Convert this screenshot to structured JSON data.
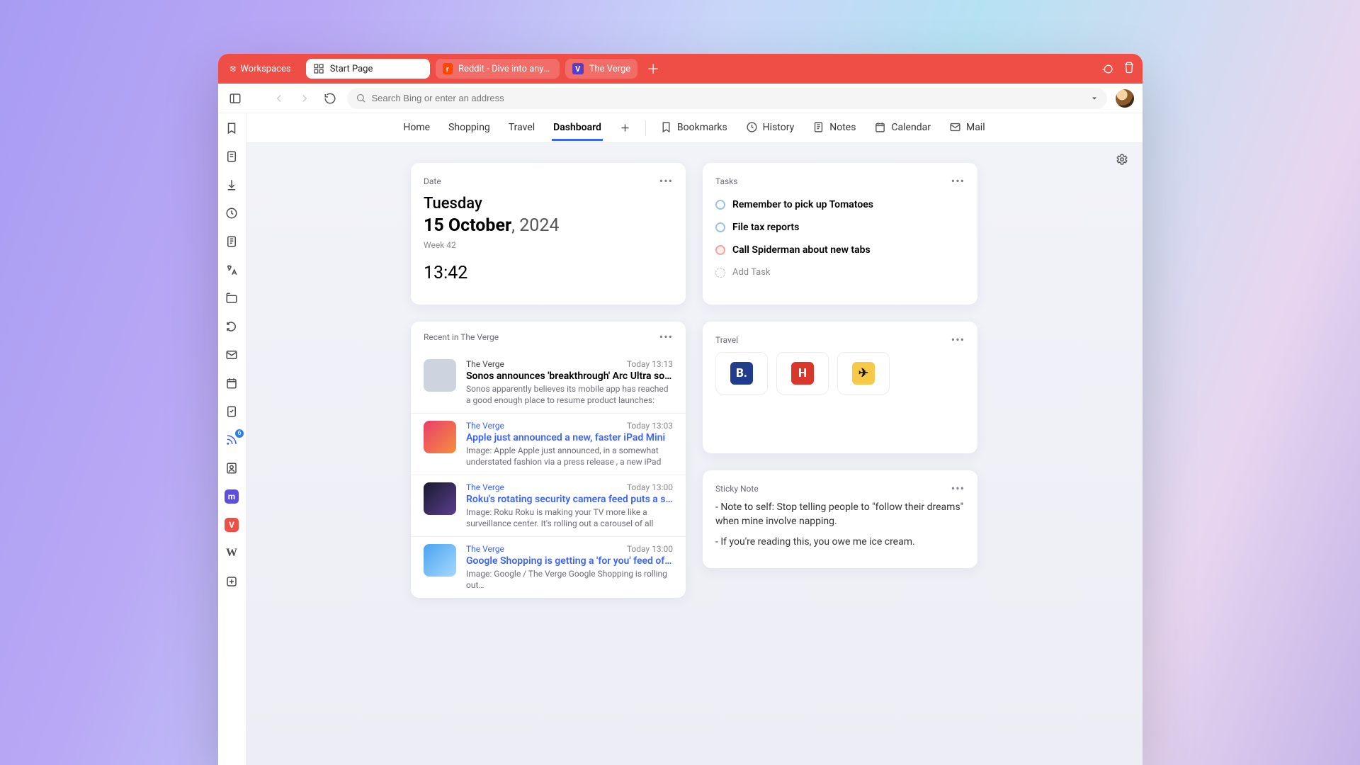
{
  "header": {
    "workspaces_label": "Workspaces",
    "tabs": [
      {
        "label": "Start Page",
        "active": true
      },
      {
        "label": "Reddit - Dive into anything",
        "active": false,
        "favicon": "reddit"
      },
      {
        "label": "The Verge",
        "active": false,
        "favicon": "verge"
      }
    ]
  },
  "address_bar": {
    "placeholder": "Search Bing or enter an address",
    "value": ""
  },
  "side_panel": {
    "feed_badge": "6"
  },
  "page_tabs": {
    "left": [
      "Home",
      "Shopping",
      "Travel",
      "Dashboard"
    ],
    "active": "Dashboard",
    "right": [
      {
        "icon": "bookmark",
        "label": "Bookmarks"
      },
      {
        "icon": "history",
        "label": "History"
      },
      {
        "icon": "notes",
        "label": "Notes"
      },
      {
        "icon": "calendar",
        "label": "Calendar"
      },
      {
        "icon": "mail",
        "label": "Mail"
      }
    ]
  },
  "widgets": {
    "date": {
      "title": "Date",
      "weekday": "Tuesday",
      "date_part": "15 October",
      "year_part": ", 2024",
      "week": "Week 42",
      "time": "13:42"
    },
    "tasks": {
      "title": "Tasks",
      "items": [
        {
          "label": "Remember to pick up Tomatoes",
          "variant": ""
        },
        {
          "label": "File tax reports",
          "variant": ""
        },
        {
          "label": "Call Spiderman about new tabs",
          "variant": "red"
        }
      ],
      "add_label": "Add Task"
    },
    "feed": {
      "title": "Recent in The Verge",
      "source": "The Verge",
      "items": [
        {
          "ts": "Today 13:13",
          "headline": "Sonos announces 'breakthrough' Arc Ultra sou…",
          "excerpt": "Sonos apparently believes its mobile app has reached a good enough place to resume product launches: today…",
          "visited": false,
          "thumb": "t1"
        },
        {
          "ts": "Today 13:03",
          "headline": "Apple just announced a new, faster iPad Mini",
          "excerpt": "Image: Apple Apple just announced, in a somewhat understated fashion via a press release , a new iPad Mi…",
          "visited": true,
          "thumb": "t2"
        },
        {
          "ts": "Today 13:00",
          "headline": "Roku's rotating security camera feed puts a sur…",
          "excerpt": "Image: Roku Roku is making your TV more like a surveillance center. It's rolling out a carousel of all your…",
          "visited": true,
          "thumb": "t3"
        },
        {
          "ts": "Today 13:00",
          "headline": "Google Shopping is getting a 'for you' feed of p…",
          "excerpt": "Image: Google / The Verge Google Shopping is rolling out…",
          "visited": true,
          "thumb": "t4"
        }
      ]
    },
    "travel": {
      "title": "Travel",
      "sites": [
        {
          "name": "booking",
          "glyph": "B.",
          "bg": "#203c8c"
        },
        {
          "name": "hotels",
          "glyph": "H",
          "bg": "#d9372c"
        },
        {
          "name": "expedia",
          "glyph": "✈",
          "bg": "#f7c948",
          "color": "#1a1a1a"
        }
      ]
    },
    "sticky": {
      "title": "Sticky Note",
      "lines": [
        "- Note to self: Stop telling people to \"follow their dreams\" when mine involve napping.",
        "- If you're reading this, you owe me ice cream."
      ]
    }
  }
}
